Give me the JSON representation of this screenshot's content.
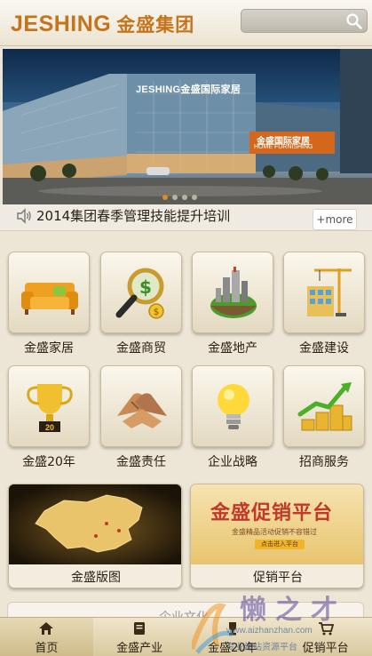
{
  "header": {
    "logo_en": "JESHING",
    "logo_cn": "金盛集团",
    "search_placeholder": ""
  },
  "banner": {
    "building_sign": "JESHING金盛国际家居",
    "tag_cn": "金盛国际家居",
    "tag_en": "HOME FURNISHING",
    "slide_count": 4,
    "active_slide": 1
  },
  "news": {
    "headline": "2014集团春季管理技能提升培训",
    "more_label": "+more"
  },
  "grid": [
    {
      "label": "金盛家居",
      "icon": "sofa-icon"
    },
    {
      "label": "金盛商贸",
      "icon": "magnifier-money-icon"
    },
    {
      "label": "金盛地产",
      "icon": "buildings-globe-icon"
    },
    {
      "label": "金盛建设",
      "icon": "construction-crane-icon"
    },
    {
      "label": "金盛20年",
      "icon": "trophy-icon"
    },
    {
      "label": "金盛责任",
      "icon": "handshake-icon"
    },
    {
      "label": "企业战略",
      "icon": "lightbulb-icon"
    },
    {
      "label": "招商服务",
      "icon": "coins-chart-icon"
    }
  ],
  "cards": [
    {
      "label": "金盛版图",
      "icon": "china-map-icon"
    },
    {
      "label": "促销平台",
      "promo_title": "金盛促销平台",
      "promo_sub": "金盛精品活动促销不容错过",
      "promo_btn": "点击进入平台"
    }
  ],
  "next_section": {
    "label": "企业文化"
  },
  "bottom_nav": [
    {
      "label": "首页",
      "icon": "home-icon",
      "active": true
    },
    {
      "label": "金盛产业",
      "icon": "book-icon",
      "active": false
    },
    {
      "label": "金盛20年",
      "icon": "trophy-small-icon",
      "active": false
    },
    {
      "label": "促销平台",
      "icon": "cart-icon",
      "active": false
    }
  ],
  "watermark": {
    "big": "懒之才",
    "url": "www.aizhanzhan.com",
    "sub": "专业建站资源平台"
  },
  "colors": {
    "brand_orange": "#c5741c",
    "background": "#ede6d6",
    "promo_red": "#c0392b"
  }
}
